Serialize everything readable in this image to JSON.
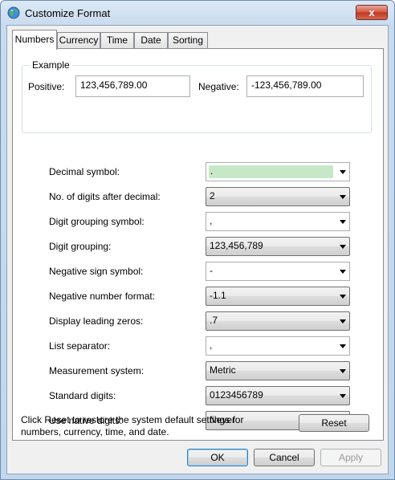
{
  "window": {
    "title": "Customize Format",
    "close_label": "x"
  },
  "tabs": [
    {
      "label": "Numbers",
      "active": true
    },
    {
      "label": "Currency"
    },
    {
      "label": "Time"
    },
    {
      "label": "Date"
    },
    {
      "label": "Sorting"
    }
  ],
  "example": {
    "title": "Example",
    "positive_label": "Positive:",
    "positive_value": "123,456,789.00",
    "negative_label": "Negative:",
    "negative_value": "-123,456,789.00"
  },
  "settings": [
    {
      "label": "Decimal symbol:",
      "value": ".",
      "editable": true,
      "selected": true
    },
    {
      "label": "No. of digits after decimal:",
      "value": "2"
    },
    {
      "label": "Digit grouping symbol:",
      "value": ",",
      "editable": true
    },
    {
      "label": "Digit grouping:",
      "value": "123,456,789"
    },
    {
      "label": "Negative sign symbol:",
      "value": "-",
      "editable": true
    },
    {
      "label": "Negative number format:",
      "value": "-1.1"
    },
    {
      "label": "Display leading zeros:",
      "value": ".7"
    },
    {
      "label": "List separator:",
      "value": ",",
      "editable": true
    },
    {
      "label": "Measurement system:",
      "value": "Metric"
    },
    {
      "label": "Standard digits:",
      "value": "0123456789"
    },
    {
      "label": "Use native digits:",
      "value": "Never"
    }
  ],
  "reset": {
    "text_line1": "Click Reset to restore the system default settings for",
    "text_line2": "numbers, currency, time, and date.",
    "button": "Reset"
  },
  "buttons": {
    "ok": "OK",
    "cancel": "Cancel",
    "apply": "Apply"
  },
  "icons": {
    "title": "globe-icon",
    "dropdown": "chevron-down-icon"
  }
}
